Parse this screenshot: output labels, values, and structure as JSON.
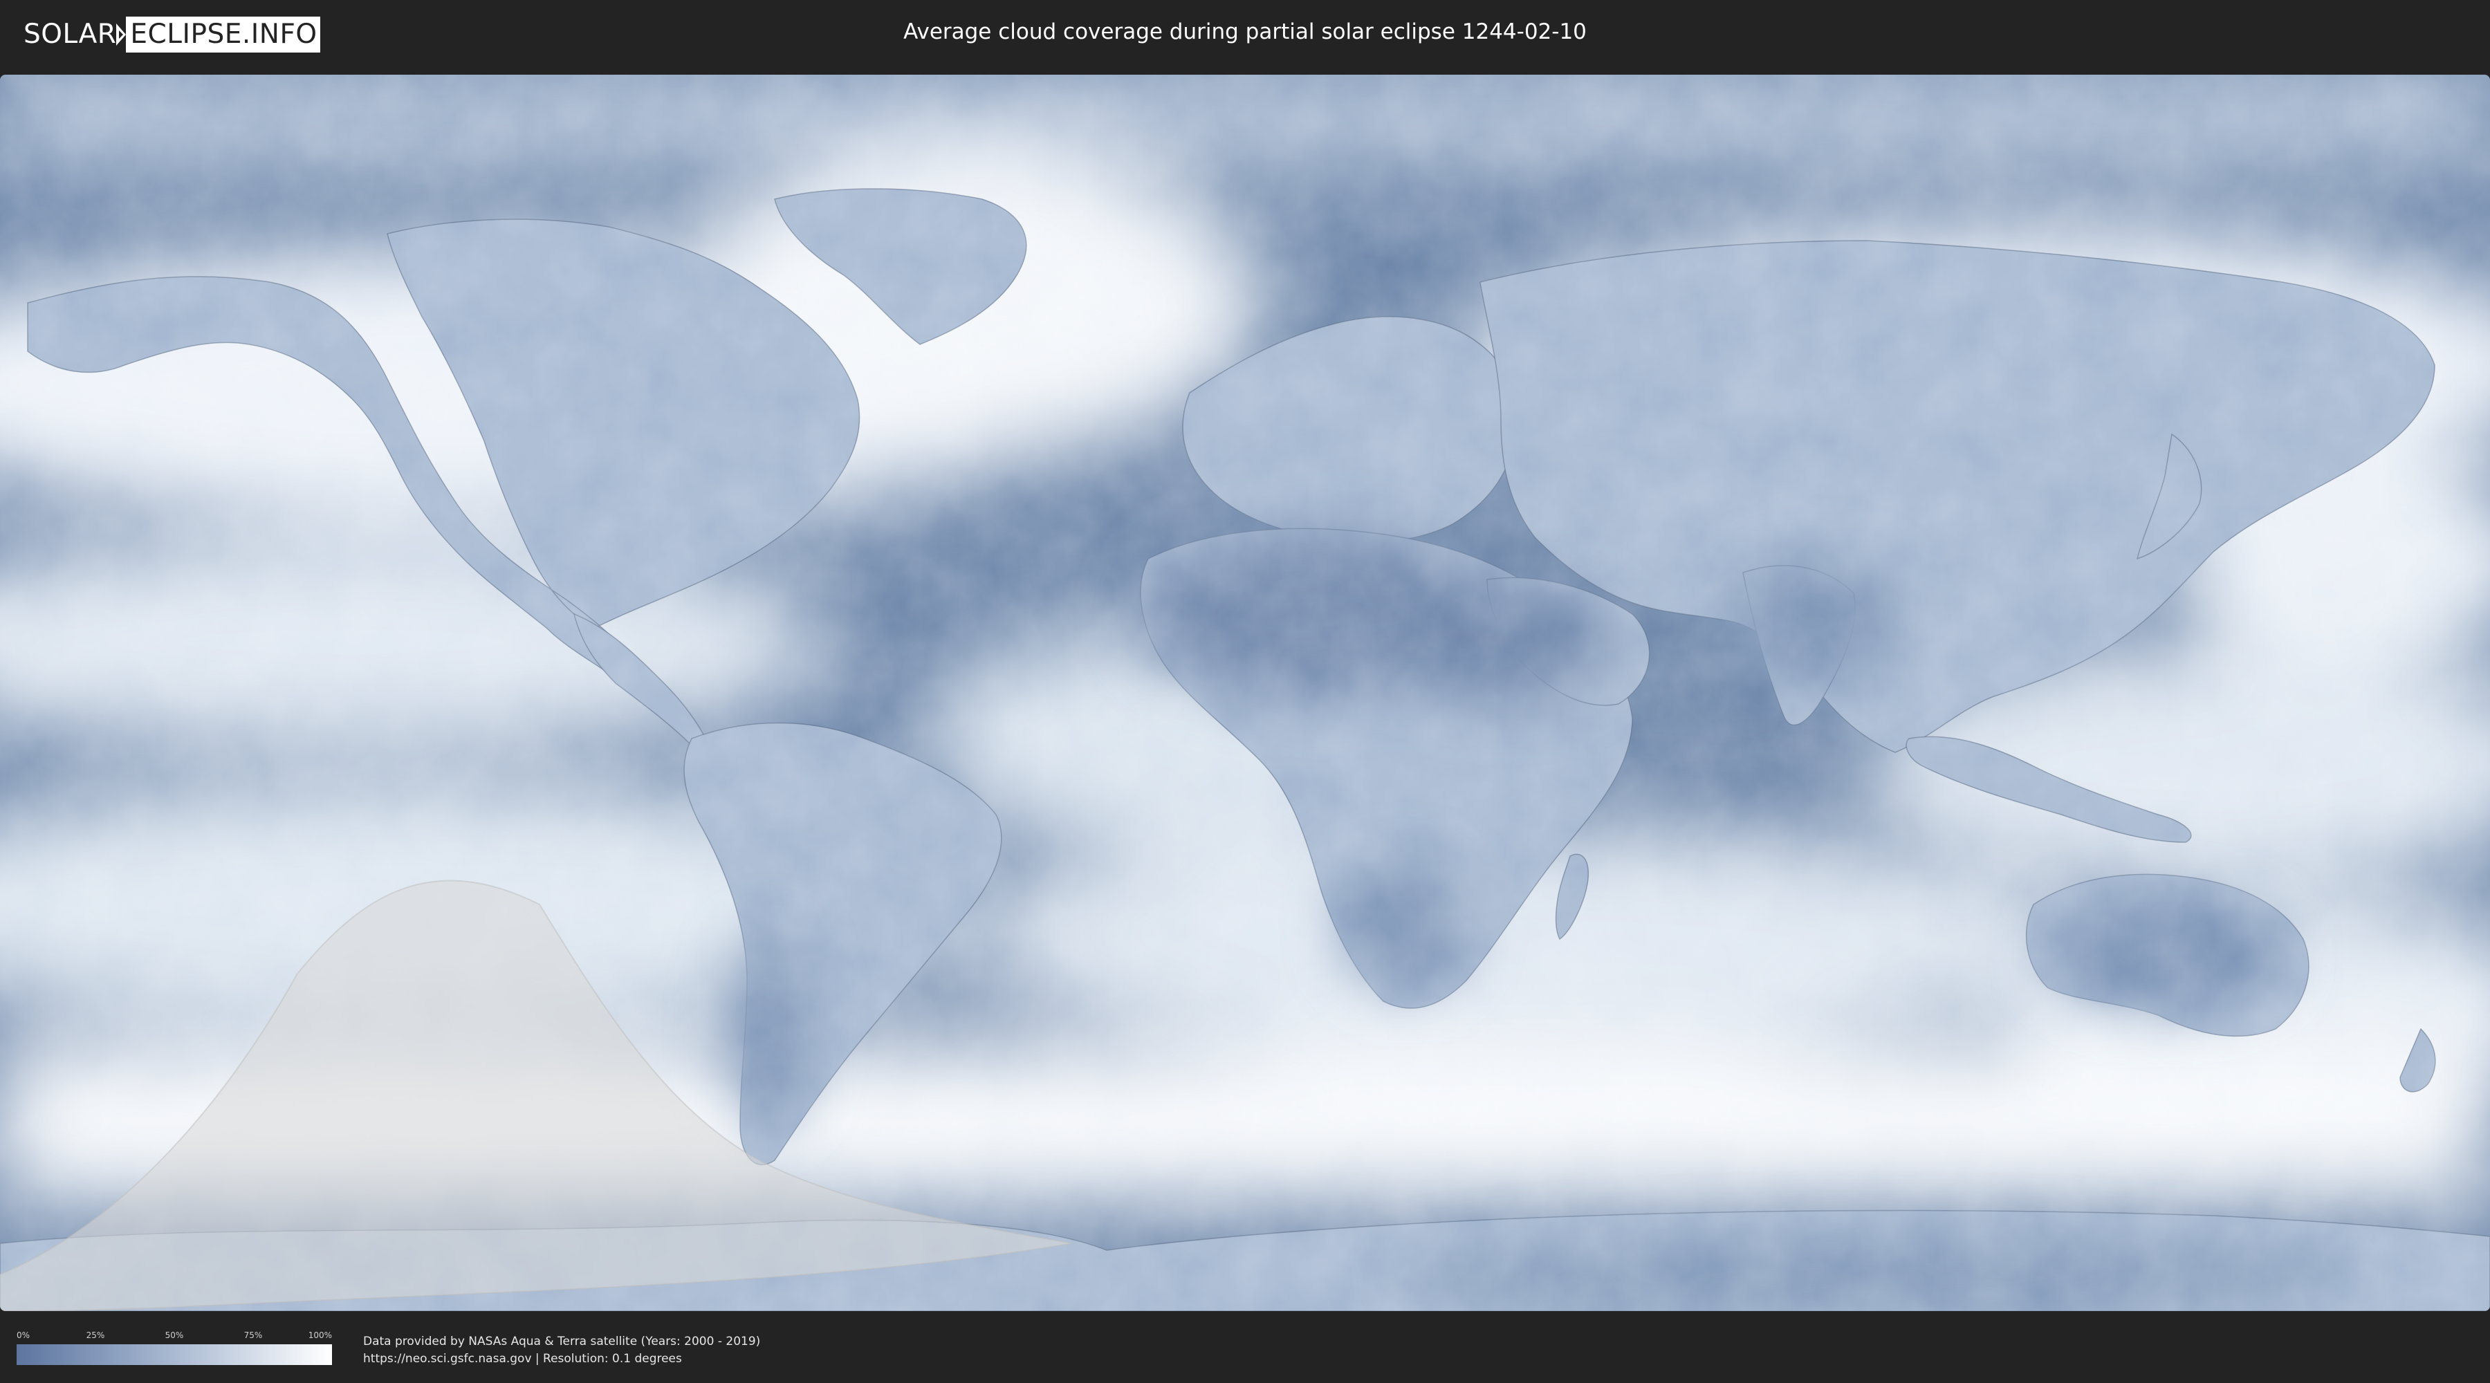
{
  "header": {
    "logo_left": "SOLAR",
    "logo_right": "ECLIPSE.INFO",
    "title": "Average cloud coverage during partial solar eclipse 1244-02-10"
  },
  "map": {
    "ocean_color": "#6a84a8",
    "cloud_color": "#ffffff",
    "land_color": "#9fb3cf",
    "desert_color": "#6e86ab",
    "eclipse_zone_color": "#d9d9d9",
    "icons": [
      "coastline-outline",
      "eclipse-visibility-zone"
    ]
  },
  "legend": {
    "ticks": [
      "0%",
      "25%",
      "50%",
      "75%",
      "100%"
    ],
    "gradient": [
      "#5d75a0",
      "#8ea2c1",
      "#c7d2e2",
      "#ffffff"
    ]
  },
  "credits": {
    "line1": "Data provided by NASAs Aqua & Terra satellite (Years: 2000 - 2019)",
    "line2": "https://neo.sci.gsfc.nasa.gov | Resolution: 0.1 degrees"
  }
}
